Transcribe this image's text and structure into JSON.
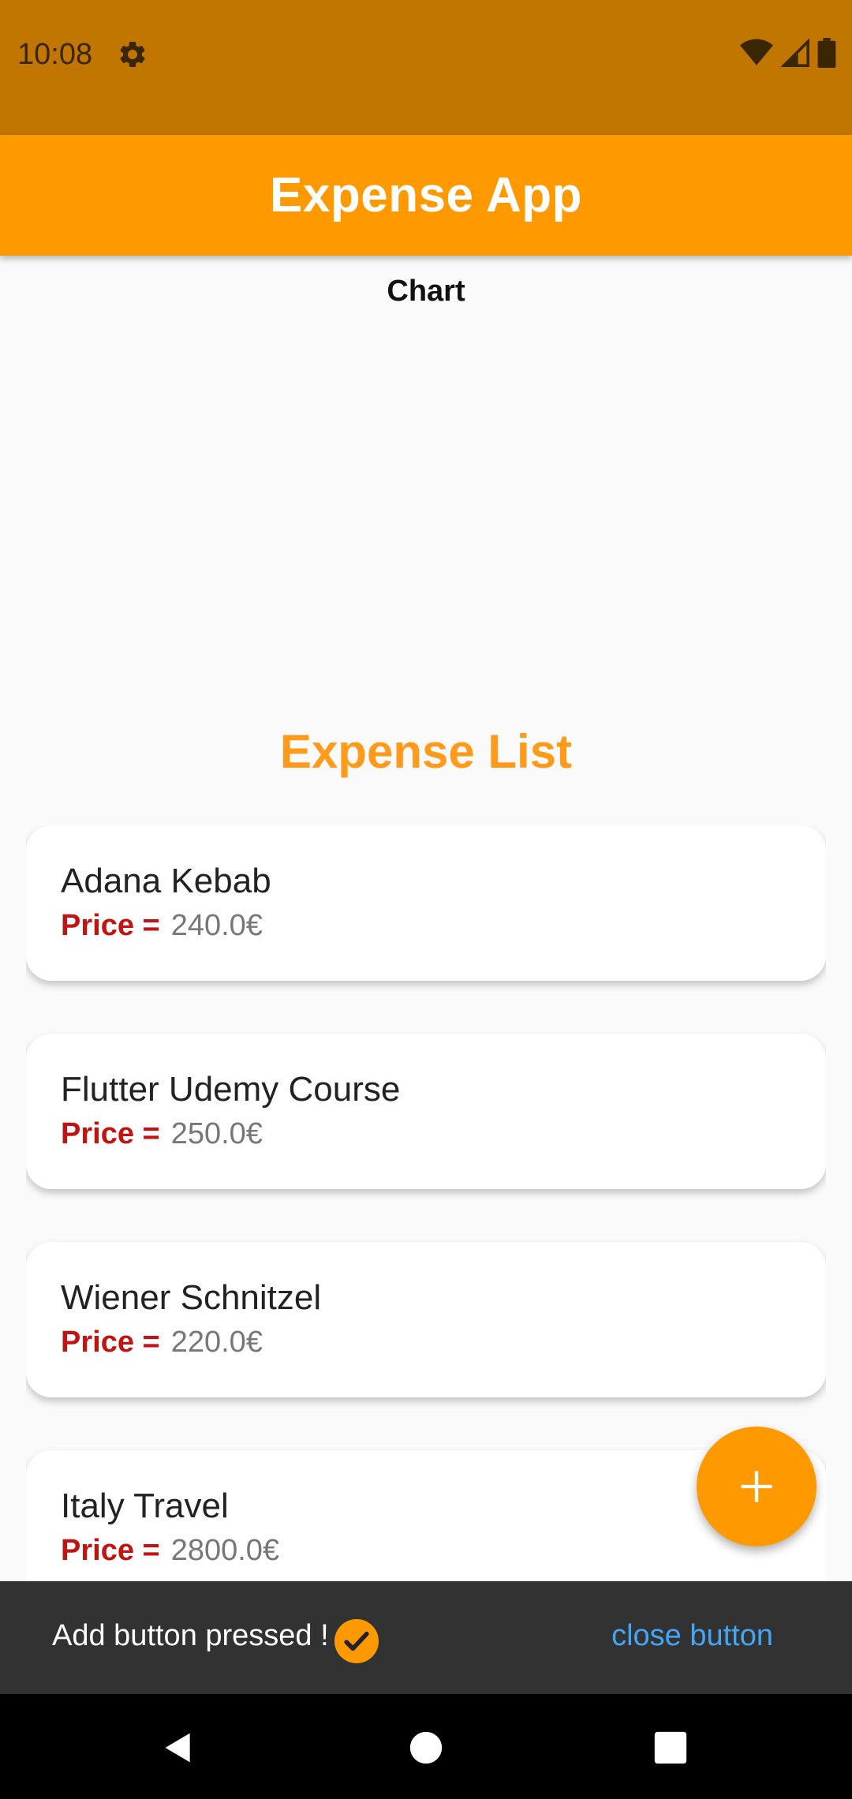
{
  "status_bar": {
    "time": "10:08",
    "icons": [
      "gear-icon",
      "wifi-icon",
      "signal-icon",
      "battery-icon"
    ]
  },
  "app_bar": {
    "title": "Expense App"
  },
  "chart": {
    "label": "Chart"
  },
  "expense_list": {
    "title": "Expense List",
    "items": [
      {
        "name": "Adana Kebab",
        "price_label": "Price =",
        "price": "240.0€"
      },
      {
        "name": "Flutter Udemy Course",
        "price_label": "Price =",
        "price": "250.0€"
      },
      {
        "name": "Wiener Schnitzel",
        "price_label": "Price =",
        "price": "220.0€"
      },
      {
        "name": "Italy Travel",
        "price_label": "Price =",
        "price": "2800.0€"
      }
    ]
  },
  "fab": {
    "icon": "plus-icon"
  },
  "snackbar": {
    "message": "Add button pressed !",
    "icon": "check-circle-icon",
    "action_label": "close button"
  },
  "nav_bar": {
    "icons": [
      "back-icon",
      "home-icon",
      "recents-icon"
    ]
  },
  "colors": {
    "status_bar": "#c17600",
    "primary": "#ff9900",
    "price_label": "#c31212",
    "snackbar_bg": "#323232",
    "snackbar_action": "#42a5f5"
  }
}
